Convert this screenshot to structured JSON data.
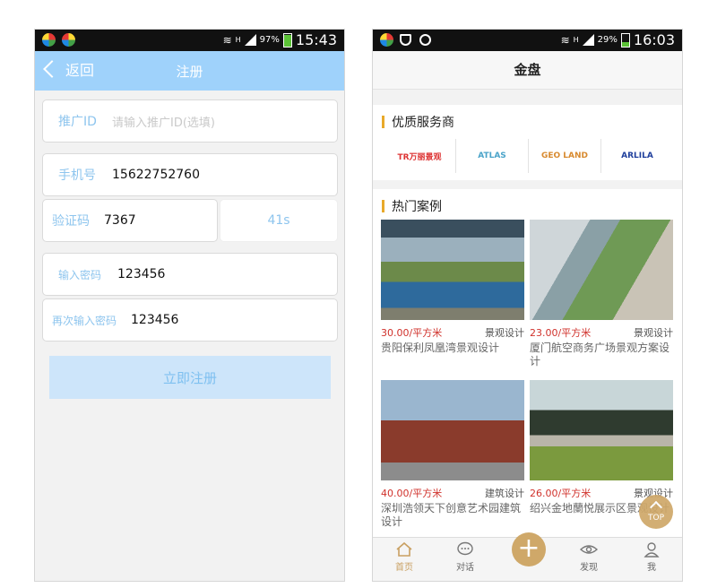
{
  "left": {
    "status": {
      "time": "15:43",
      "battery": "97%",
      "network": "H"
    },
    "header": {
      "back_label": "返回",
      "title": "注册"
    },
    "form": {
      "promo_label": "推广ID",
      "promo_placeholder": "请输入推广ID(选填)",
      "phone_label": "手机号",
      "phone_value": "15622752760",
      "code_label": "验证码",
      "code_value": "7367",
      "countdown": "41s",
      "password_label": "输入密码",
      "password_value": "123456",
      "confirm_label": "再次输入密码",
      "confirm_value": "123456",
      "submit_label": "立即注册"
    }
  },
  "right": {
    "status": {
      "time": "16:03",
      "battery": "29%",
      "network": "H"
    },
    "header": {
      "title": "金盘"
    },
    "providers": {
      "title": "优质服务商",
      "logos": [
        "TR万丽景观",
        "ATLAS",
        "GEO LAND",
        "ARLILA"
      ]
    },
    "cases": {
      "title": "热门案例",
      "items": [
        {
          "price": "30.00/平方米",
          "type": "景观设计",
          "title": "贵阳保利凤凰湾景观设计"
        },
        {
          "price": "23.00/平方米",
          "type": "景观设计",
          "title": "厦门航空商务广场景观方案设计"
        },
        {
          "price": "40.00/平方米",
          "type": "建筑设计",
          "title": "深圳浩领天下创意艺术园建筑设计"
        },
        {
          "price": "26.00/平方米",
          "type": "景观设计",
          "title": "绍兴金地蘭悦展示区景观设计"
        }
      ]
    },
    "top_label": "TOP",
    "tabs": [
      {
        "label": "首页"
      },
      {
        "label": "对话"
      },
      {
        "label": "发现"
      },
      {
        "label": "我"
      }
    ]
  }
}
